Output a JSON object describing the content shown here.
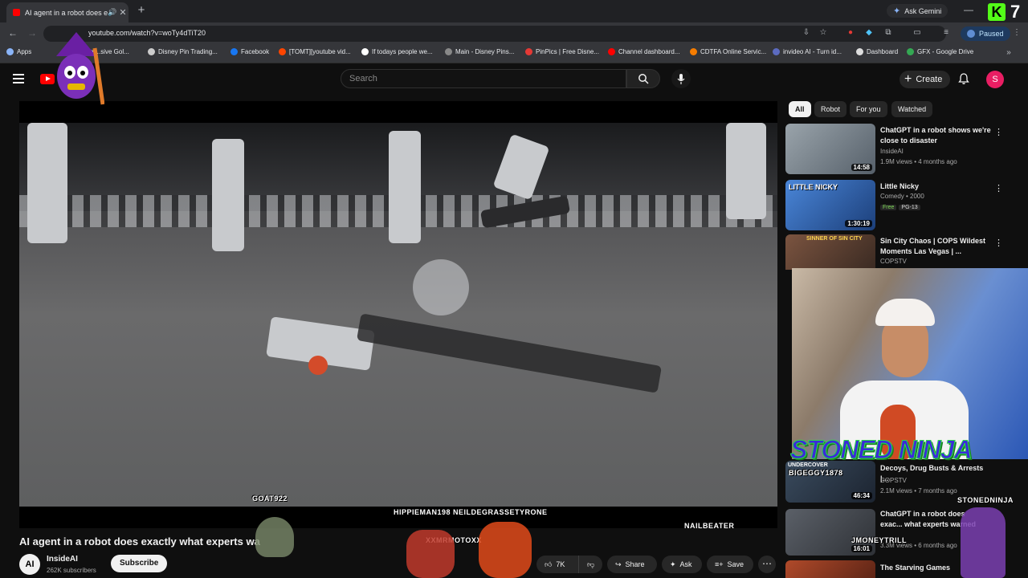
{
  "browser": {
    "tab_title": "AI agent in a robot does ex",
    "url": "youtube.com/watch?v=woTy4dTiT20",
    "ask_gemini": "Ask Gemini",
    "profile_status": "Paused",
    "kick_number": "7",
    "bookmarks": [
      {
        "label": "Apps",
        "color": "#8ab4f8"
      },
      {
        "label": "Compr...sive Gol...",
        "color": "#aaaaaa"
      },
      {
        "label": "Disney Pin Trading...",
        "color": "#cccccc"
      },
      {
        "label": "Facebook",
        "color": "#1877f2"
      },
      {
        "label": "[TOMT][youtube vid...",
        "color": "#ff4500"
      },
      {
        "label": "If todays people we...",
        "color": "#ffffff"
      },
      {
        "label": "Main - Disney Pins...",
        "color": "#888888"
      },
      {
        "label": "PinPics | Free Disne...",
        "color": "#e53935"
      },
      {
        "label": "Channel dashboard...",
        "color": "#ff0000"
      },
      {
        "label": "CDTFA Online Servic...",
        "color": "#f57c00"
      },
      {
        "label": "invideo AI - Turn id...",
        "color": "#5c6bc0"
      },
      {
        "label": "Dashboard",
        "color": "#dddddd"
      },
      {
        "label": "GFX - Google Drive",
        "color": "#34a853"
      }
    ]
  },
  "youtube": {
    "search_placeholder": "Search",
    "create_label": "Create",
    "avatar_letter": "S"
  },
  "video": {
    "title": "AI agent in a robot does exactly what experts wa",
    "channel_name": "InsideAI",
    "channel_initials": "AI",
    "subscribers": "262K subscribers",
    "subscribe_label": "Subscribe",
    "like_count": "7K",
    "share_label": "Share",
    "ask_label": "Ask",
    "save_label": "Save",
    "overlay_names": {
      "goat": "GOAT922",
      "hippie": "HIPPIEMAN198 NEILDEGRASSETYRONE",
      "nail": "NAILBEATER",
      "xx": "XXMRMOTOXX",
      "bigeggy": "BIGEGGY1878",
      "stoned": "STONEDNINJA",
      "moneytrill": "JMONEYTRILL"
    }
  },
  "chips": [
    "All",
    "Robot",
    "For you",
    "Watched"
  ],
  "recommendations": [
    {
      "title": "ChatGPT in a robot shows we're close to disaster",
      "channel": "InsideAI",
      "meta": "1.9M views • 4 months ago",
      "duration": "14:58",
      "color": "#7c8a94"
    },
    {
      "title": "Little Nicky",
      "channel": "Comedy • 2000",
      "badges": [
        "Free",
        "PG-13"
      ],
      "duration": "1:30:19",
      "color": "#3b6fb8",
      "thumb_text": "LITTLE NICKY"
    },
    {
      "title": "Sin City Chaos | COPS Wildest Moments Las Vegas | ...",
      "channel": "COPSTV",
      "color": "#6b4a3a",
      "thumb_text": "SINNER OF SIN CITY"
    },
    {
      "title": "Decoys, Drug Busts & Arrests |...",
      "channel": "COPSTV",
      "meta": "2.1M views • 7 months ago",
      "duration": "46:34",
      "color": "#2d3a48",
      "thumb_text": "UNDERCOVER"
    },
    {
      "title": "ChatGPT in a robot does exac... what experts warned",
      "channel": "",
      "meta": "3.3M views • 6 months ago",
      "duration": "16:01",
      "color": "#4a4f56"
    },
    {
      "title": "The Starving Games",
      "color": "#8a3b2a"
    }
  ],
  "webcam": {
    "banner": "STONED NINJA"
  }
}
